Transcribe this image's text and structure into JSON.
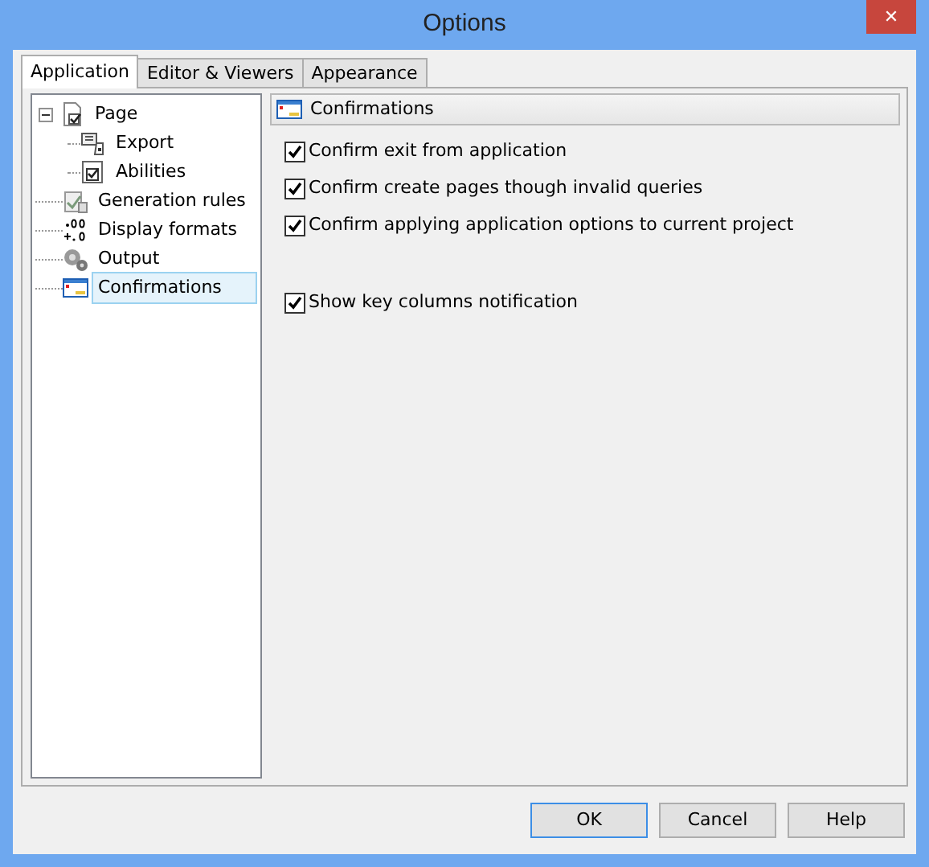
{
  "window": {
    "title": "Options",
    "close": "✕"
  },
  "tabs": [
    {
      "label": "Application",
      "selected": true
    },
    {
      "label": "Editor & Viewers",
      "selected": false
    },
    {
      "label": "Appearance",
      "selected": false
    }
  ],
  "tree": [
    {
      "label": "Page",
      "kind": "page",
      "selected": false,
      "expanded": true,
      "children": [
        {
          "label": "Export",
          "kind": "export",
          "selected": false
        },
        {
          "label": "Abilities",
          "kind": "abilities",
          "selected": false
        }
      ]
    },
    {
      "label": "Generation rules",
      "kind": "rules",
      "selected": false
    },
    {
      "label": "Display formats",
      "kind": "formats",
      "selected": false
    },
    {
      "label": "Output",
      "kind": "output",
      "selected": false
    },
    {
      "label": "Confirmations",
      "kind": "confirm",
      "selected": true
    }
  ],
  "panel": {
    "title": "Confirmations"
  },
  "options": [
    {
      "label": "Confirm exit from application",
      "checked": true
    },
    {
      "label": "Confirm create pages though invalid queries",
      "checked": true
    },
    {
      "label": "Confirm applying application options to current project",
      "checked": true
    },
    {
      "label": "Show key columns notification",
      "checked": true,
      "separated": true
    }
  ],
  "buttons": [
    {
      "label": "OK",
      "default": true
    },
    {
      "label": "Cancel",
      "default": false
    },
    {
      "label": "Help",
      "default": false
    }
  ]
}
